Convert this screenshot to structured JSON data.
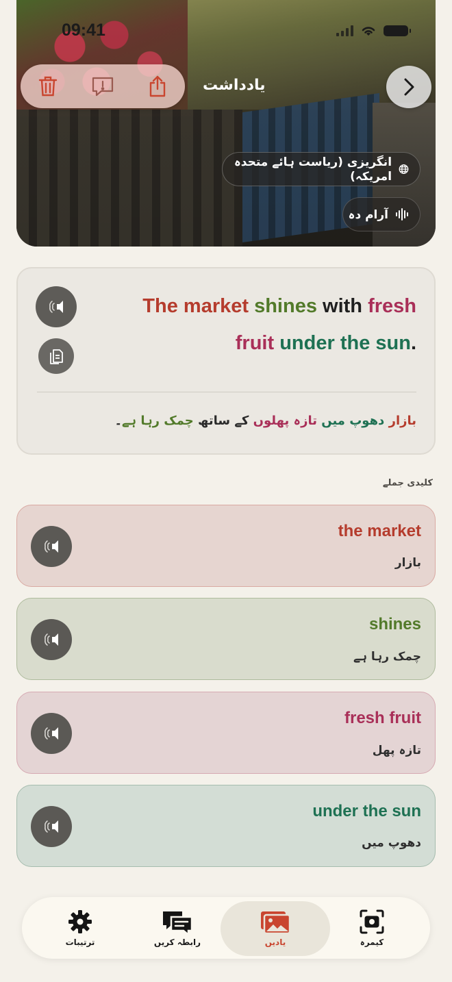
{
  "status_bar": {
    "time": "09:41"
  },
  "header": {
    "title": "یادداشت",
    "language": "انگریزی (ریاست ہائے متحدہ امریکہ)",
    "voice": "آرام دہ"
  },
  "sentence": {
    "english_words": [
      {
        "text": "The market",
        "color": "#b53c2d"
      },
      {
        "text": " ",
        "color": "#1f1f1f"
      },
      {
        "text": "shines",
        "color": "#527a2a"
      },
      {
        "text": " with ",
        "color": "#1f1f1f"
      },
      {
        "text": "fresh fruit",
        "color": "#a92f58"
      },
      {
        "text": " ",
        "color": "#1f1f1f"
      },
      {
        "text": "under the sun",
        "color": "#1e7153"
      },
      {
        "text": ".",
        "color": "#1f1f1f"
      }
    ],
    "urdu_words": [
      {
        "text": "بازار",
        "color": "#b53c2d"
      },
      {
        "text": " دھوپ میں ",
        "color": "#1e7153"
      },
      {
        "text": "تازہ پھلوں",
        "color": "#a92f58"
      },
      {
        "text": " کے ساتھ ",
        "color": "#2a2a2a"
      },
      {
        "text": "چمک رہا ہے",
        "color": "#527a2a"
      },
      {
        "text": "۔",
        "color": "#2a2a2a"
      }
    ]
  },
  "key_phrases_label": "کلیدی جملے",
  "phrases": [
    {
      "en": "the market",
      "ur": "بازار",
      "color": "#b53c2d"
    },
    {
      "en": "shines",
      "ur": "چمک رہا ہے",
      "color": "#527a2a"
    },
    {
      "en": "fresh fruit",
      "ur": "تازہ پھل",
      "color": "#a92f58"
    },
    {
      "en": "under the sun",
      "ur": "دھوپ میں",
      "color": "#1e7153"
    }
  ],
  "tabs": [
    {
      "label": "ترتیبات",
      "icon": "gear-icon"
    },
    {
      "label": "رابطہ کریں",
      "icon": "chat-icon"
    },
    {
      "label": "یادیں",
      "icon": "photos-icon",
      "active": true
    },
    {
      "label": "کیمرہ",
      "icon": "camera-icon"
    }
  ],
  "colors": {
    "accent": "#c9452f"
  }
}
